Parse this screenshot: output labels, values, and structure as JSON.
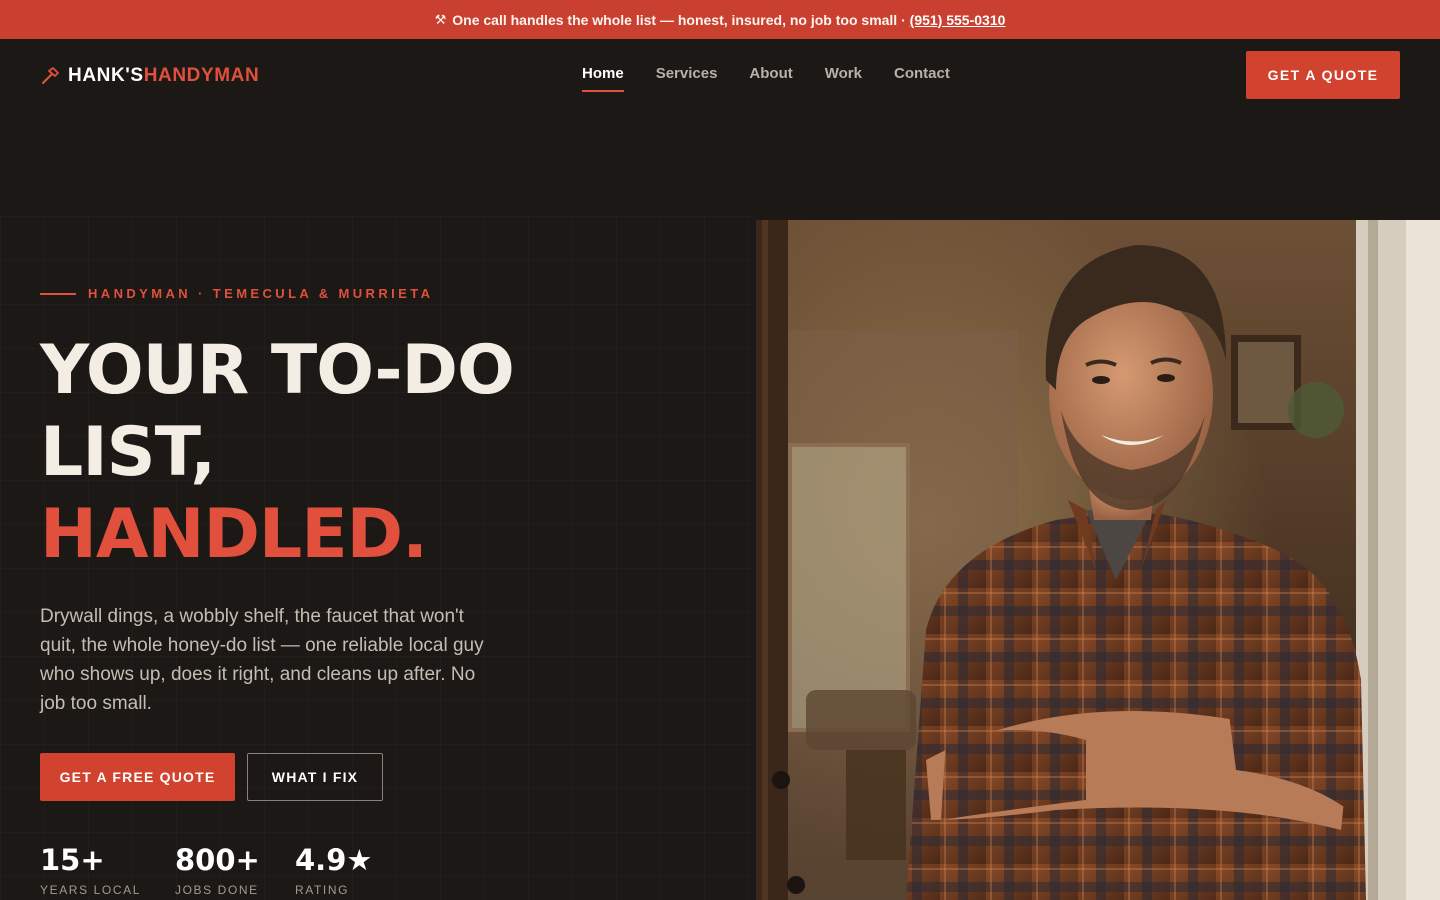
{
  "announcement": {
    "icon": "hammer-icon",
    "text": "One call handles the whole list — honest, insured, no job too small ·",
    "phone": "(951) 555-0310"
  },
  "header": {
    "logo_first": "HANK'S",
    "logo_second": "HANDYMAN",
    "logo_icon": "hammer-icon",
    "nav": [
      {
        "label": "Home",
        "active": true
      },
      {
        "label": "Services",
        "active": false
      },
      {
        "label": "About",
        "active": false
      },
      {
        "label": "Work",
        "active": false
      },
      {
        "label": "Contact",
        "active": false
      }
    ],
    "cta_label": "GET A QUOTE"
  },
  "hero": {
    "eyebrow": "HANDYMAN · TEMECULA & MURRIETA",
    "headline_line1": "YOUR TO-DO",
    "headline_line2": "LIST,",
    "headline_line3": "HANDLED.",
    "lede": "Drywall dings, a wobbly shelf, the faucet that won't quit, the whole honey-do list — one reliable local guy who shows up, does it right, and cleans up after. No job too small.",
    "primary_cta": "GET A FREE QUOTE",
    "secondary_cta": "WHAT I FIX",
    "stats": [
      {
        "value": "15+",
        "label": "YEARS LOCAL"
      },
      {
        "value": "800+",
        "label": "JOBS DONE"
      },
      {
        "value": "4.9★",
        "label": "RATING"
      }
    ]
  },
  "colors": {
    "accent": "#d1432f",
    "accent_text": "#e0503c",
    "background": "#1b1816",
    "banner": "#c94030",
    "text": "#f3ede4"
  }
}
